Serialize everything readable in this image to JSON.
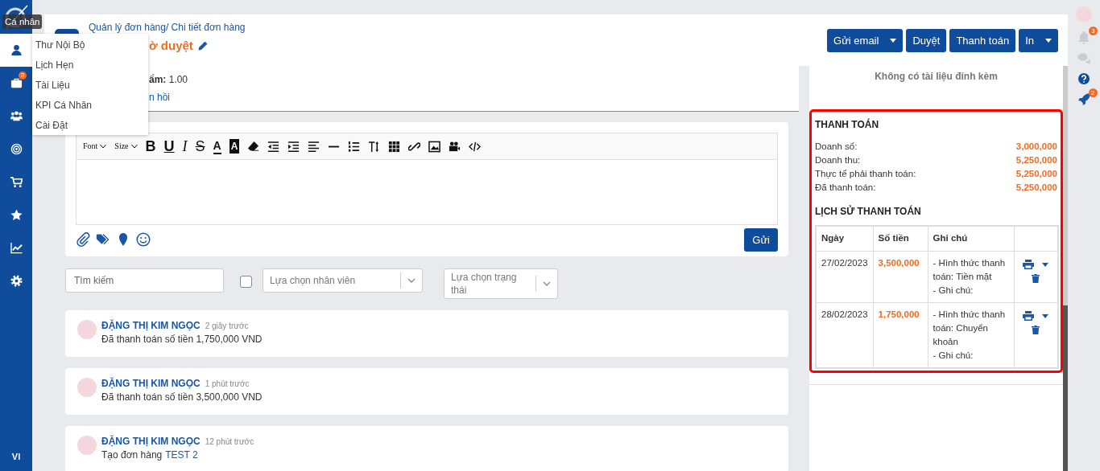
{
  "sidebar": {
    "tooltip": "Cá nhân",
    "items": [
      {
        "selected": true
      },
      {
        "selected": false,
        "badge": "3"
      },
      {
        "selected": false
      },
      {
        "selected": false
      },
      {
        "selected": false
      },
      {
        "selected": false
      },
      {
        "selected": false
      },
      {
        "selected": false
      }
    ],
    "language": "VI"
  },
  "personal_menu": {
    "items": [
      "Thư Nội Bộ",
      "Lịch Hẹn",
      "Tài Liệu",
      "KPI Cá Nhân",
      "Cài Đặt"
    ]
  },
  "header": {
    "breadcrumb": "Quản lý đơn hàng/ Chi tiết đơn hàng",
    "title": "ờ duyệt",
    "buttons": [
      {
        "label": "Gửi email",
        "split": true
      },
      {
        "label": "Duyệt",
        "split": false
      },
      {
        "label": "Thanh toán",
        "split": false
      },
      {
        "label": "In",
        "split": true
      }
    ]
  },
  "details": {
    "field": "**ẩm:** 1.00",
    "link": "n hồi"
  },
  "editor": {
    "toolbar": [
      {
        "kind": "dropdown",
        "label": "Font"
      },
      {
        "kind": "dropdown",
        "label": "Size"
      },
      {
        "kind": "bold",
        "label": "B"
      },
      {
        "kind": "underline",
        "label": "U"
      },
      {
        "kind": "italic",
        "label": "I"
      },
      {
        "kind": "strike",
        "label": "S"
      },
      {
        "kind": "font-color",
        "label": "A"
      },
      {
        "kind": "highlight",
        "label": "A"
      },
      {
        "kind": "eraser"
      },
      {
        "kind": "outdent"
      },
      {
        "kind": "indent"
      },
      {
        "kind": "align"
      },
      {
        "kind": "rule"
      },
      {
        "kind": "ordered-list"
      },
      {
        "kind": "line-height"
      },
      {
        "kind": "table"
      },
      {
        "kind": "link"
      },
      {
        "kind": "image"
      },
      {
        "kind": "video"
      },
      {
        "kind": "code"
      }
    ],
    "send_button": "Gửi"
  },
  "filters": {
    "search_placeholder": "Tìm kiếm",
    "checkbox": {
      "checked": false
    },
    "employee_placeholder": "Lựa chọn nhân viên",
    "status_placeholder": "Lựa chọn trạng thái"
  },
  "activity": [
    {
      "author": "ĐẶNG THỊ KIM NGỌC",
      "time": "2 giây trước",
      "message": "Đã thanh toán số tiền 1,750,000 VND"
    },
    {
      "author": "ĐẶNG THỊ KIM NGỌC",
      "time": "1 phút trước",
      "message": "Đã thanh toán số tiền 3,500,000 VND"
    },
    {
      "author": "ĐẶNG THỊ KIM NGỌC",
      "time": "12 phút trước",
      "message": "Tạo đơn hàng",
      "link": "TEST 2"
    }
  ],
  "attachments": {
    "empty_text": "Không có tài liệu đính kèm"
  },
  "payment": {
    "title": "THANH TOÁN",
    "summary": [
      {
        "label": "Doanh số:",
        "value": "3,000,000"
      },
      {
        "label": "Doanh thu:",
        "value": "5,250,000"
      },
      {
        "label": "Thực tế phải thanh toán:",
        "value": "5,250,000"
      },
      {
        "label": "Đã thanh toán:",
        "value": "5,250,000"
      }
    ],
    "history_title": "LỊCH SỬ THANH TOÁN",
    "columns": [
      "Ngày",
      "Số tiền",
      "Ghi chú"
    ],
    "rows": [
      {
        "date": "27/02/2023",
        "amount": "3,500,000",
        "note": [
          "- Hình thức thanh toán: Tiền mặt",
          "- Ghi chú:"
        ]
      },
      {
        "date": "28/02/2023",
        "amount": "1,750,000",
        "note": [
          "- Hình thức thanh toán: Chuyển khoản",
          "- Ghi chú:"
        ]
      }
    ]
  },
  "right_rail": {
    "notifications_badge": "3",
    "launch_badge": "2"
  }
}
